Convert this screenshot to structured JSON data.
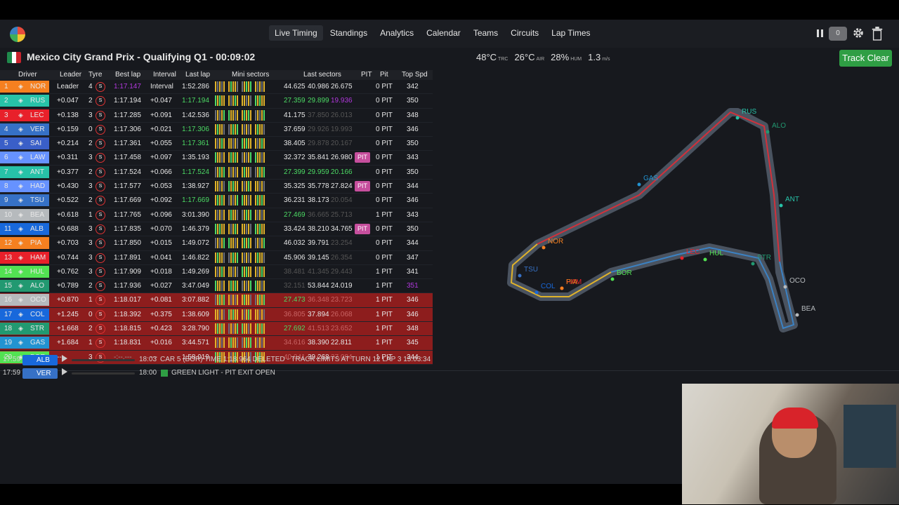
{
  "nav": {
    "tabs": [
      "Live Timing",
      "Standings",
      "Analytics",
      "Calendar",
      "Teams",
      "Circuits",
      "Lap Times"
    ],
    "active": 0,
    "counter": "0"
  },
  "session": {
    "title": "Mexico City Grand Prix - Qualifying Q1 - 00:09:02",
    "flag_colors": [
      "#1f8a4c",
      "#ffffff",
      "#c8232c"
    ]
  },
  "weather": [
    {
      "v": "48°C",
      "u": "TRC"
    },
    {
      "v": "26°C",
      "u": "AIR"
    },
    {
      "v": "28%",
      "u": "HUM"
    },
    {
      "v": "1.3",
      "u": "m/s"
    }
  ],
  "status_button": "Track Clear",
  "columns": {
    "driver": "Driver",
    "leader": "Leader",
    "tyre": "Tyre",
    "best": "Best lap",
    "interval": "Interval",
    "last": "Last lap",
    "mini": "Mini sectors",
    "sectors": "Last sectors",
    "pit": "PIT",
    "pits": "Pit",
    "speed": "Top Spd"
  },
  "rows": [
    {
      "pos": "1",
      "code": "NOR",
      "color": "#f58020",
      "gap": "Leader",
      "tyres": "4",
      "best": "1:17.147",
      "best_color": "#b138dd",
      "interval": "Interval",
      "last": "1:52.286",
      "last_color": "#e6e6e6",
      "s1": "44.625",
      "s2": "40.986",
      "s3": "26.675",
      "s1c": "#e6e6e6",
      "s2c": "#e6e6e6",
      "s3c": "#e6e6e6",
      "pit": "",
      "pits": "0 PIT",
      "speed": "342",
      "red": false
    },
    {
      "pos": "2",
      "code": "RUS",
      "color": "#27c2a8",
      "gap": "+0.047",
      "tyres": "2",
      "best": "1:17.194",
      "best_color": "#e6e6e6",
      "interval": "+0.047",
      "last": "1:17.194",
      "last_color": "#4cd964",
      "s1": "27.359",
      "s2": "29.899",
      "s3": "19.936",
      "s1c": "#4cd964",
      "s2c": "#4cd964",
      "s3c": "#b138dd",
      "pit": "",
      "pits": "0 PIT",
      "speed": "350",
      "red": false
    },
    {
      "pos": "3",
      "code": "LEC",
      "color": "#e8202a",
      "gap": "+0.138",
      "tyres": "3",
      "best": "1:17.285",
      "best_color": "#e6e6e6",
      "interval": "+0.091",
      "last": "1:42.536",
      "last_color": "#e6e6e6",
      "s1": "41.175",
      "s2": "37.850",
      "s3": "26.013",
      "s1c": "#e6e6e6",
      "s2c": "#555",
      "s3c": "#555",
      "pit": "",
      "pits": "0 PIT",
      "speed": "348",
      "red": false
    },
    {
      "pos": "4",
      "code": "VER",
      "color": "#3671c6",
      "gap": "+0.159",
      "tyres": "0",
      "best": "1:17.306",
      "best_color": "#e6e6e6",
      "interval": "+0.021",
      "last": "1:17.306",
      "last_color": "#4cd964",
      "s1": "37.659",
      "s2": "29.926",
      "s3": "19.993",
      "s1c": "#e6e6e6",
      "s2c": "#555",
      "s3c": "#555",
      "pit": "",
      "pits": "0 PIT",
      "speed": "346",
      "red": false
    },
    {
      "pos": "5",
      "code": "SAI",
      "color": "#3a5fc8",
      "gap": "+0.214",
      "tyres": "2",
      "best": "1:17.361",
      "best_color": "#e6e6e6",
      "interval": "+0.055",
      "last": "1:17.361",
      "last_color": "#4cd964",
      "s1": "38.405",
      "s2": "29.878",
      "s3": "20.167",
      "s1c": "#e6e6e6",
      "s2c": "#555",
      "s3c": "#555",
      "pit": "",
      "pits": "0 PIT",
      "speed": "350",
      "red": false
    },
    {
      "pos": "6",
      "code": "LAW",
      "color": "#6692ff",
      "gap": "+0.311",
      "tyres": "3",
      "best": "1:17.458",
      "best_color": "#e6e6e6",
      "interval": "+0.097",
      "last": "1:35.193",
      "last_color": "#e6e6e6",
      "s1": "32.372",
      "s2": "35.841",
      "s3": "26.980",
      "s1c": "#e6e6e6",
      "s2c": "#e6e6e6",
      "s3c": "#e6e6e6",
      "pit": "PIT",
      "pits": "0 PIT",
      "speed": "343",
      "red": false
    },
    {
      "pos": "7",
      "code": "ANT",
      "color": "#27c2a8",
      "gap": "+0.377",
      "tyres": "2",
      "best": "1:17.524",
      "best_color": "#e6e6e6",
      "interval": "+0.066",
      "last": "1:17.524",
      "last_color": "#4cd964",
      "s1": "27.399",
      "s2": "29.959",
      "s3": "20.166",
      "s1c": "#4cd964",
      "s2c": "#4cd964",
      "s3c": "#4cd964",
      "pit": "",
      "pits": "0 PIT",
      "speed": "350",
      "red": false
    },
    {
      "pos": "8",
      "code": "HAD",
      "color": "#6692ff",
      "gap": "+0.430",
      "tyres": "3",
      "best": "1:17.577",
      "best_color": "#e6e6e6",
      "interval": "+0.053",
      "last": "1:38.927",
      "last_color": "#e6e6e6",
      "s1": "35.325",
      "s2": "35.778",
      "s3": "27.824",
      "s1c": "#e6e6e6",
      "s2c": "#e6e6e6",
      "s3c": "#e6e6e6",
      "pit": "PIT",
      "pits": "0 PIT",
      "speed": "344",
      "red": false
    },
    {
      "pos": "9",
      "code": "TSU",
      "color": "#3671c6",
      "gap": "+0.522",
      "tyres": "2",
      "best": "1:17.669",
      "best_color": "#e6e6e6",
      "interval": "+0.092",
      "last": "1:17.669",
      "last_color": "#4cd964",
      "s1": "36.231",
      "s2": "38.173",
      "s3": "20.054",
      "s1c": "#e6e6e6",
      "s2c": "#e6e6e6",
      "s3c": "#555",
      "pit": "",
      "pits": "0 PIT",
      "speed": "346",
      "red": false
    },
    {
      "pos": "10",
      "code": "BEA",
      "color": "#b6babd",
      "gap": "+0.618",
      "tyres": "1",
      "best": "1:17.765",
      "best_color": "#e6e6e6",
      "interval": "+0.096",
      "last": "3:01.390",
      "last_color": "#e6e6e6",
      "s1": "27.469",
      "s2": "36.665",
      "s3": "25.713",
      "s1c": "#4cd964",
      "s2c": "#555",
      "s3c": "#555",
      "pit": "",
      "pits": "1 PIT",
      "speed": "343",
      "red": false
    },
    {
      "pos": "11",
      "code": "ALB",
      "color": "#1868db",
      "gap": "+0.688",
      "tyres": "3",
      "best": "1:17.835",
      "best_color": "#e6e6e6",
      "interval": "+0.070",
      "last": "1:46.379",
      "last_color": "#e6e6e6",
      "s1": "33.424",
      "s2": "38.210",
      "s3": "34.765",
      "s1c": "#e6e6e6",
      "s2c": "#e6e6e6",
      "s3c": "#e6e6e6",
      "pit": "PIT",
      "pits": "0 PIT",
      "speed": "350",
      "red": false
    },
    {
      "pos": "12",
      "code": "PIA",
      "color": "#f58020",
      "gap": "+0.703",
      "tyres": "3",
      "best": "1:17.850",
      "best_color": "#e6e6e6",
      "interval": "+0.015",
      "last": "1:49.072",
      "last_color": "#e6e6e6",
      "s1": "46.032",
      "s2": "39.791",
      "s3": "23.254",
      "s1c": "#e6e6e6",
      "s2c": "#e6e6e6",
      "s3c": "#555",
      "pit": "",
      "pits": "0 PIT",
      "speed": "344",
      "red": false
    },
    {
      "pos": "13",
      "code": "HAM",
      "color": "#e8202a",
      "gap": "+0.744",
      "tyres": "3",
      "best": "1:17.891",
      "best_color": "#e6e6e6",
      "interval": "+0.041",
      "last": "1:46.822",
      "last_color": "#e6e6e6",
      "s1": "45.906",
      "s2": "39.145",
      "s3": "26.354",
      "s1c": "#e6e6e6",
      "s2c": "#e6e6e6",
      "s3c": "#555",
      "pit": "",
      "pits": "0 PIT",
      "speed": "347",
      "red": false
    },
    {
      "pos": "14",
      "code": "HUL",
      "color": "#52e252",
      "gap": "+0.762",
      "tyres": "3",
      "best": "1:17.909",
      "best_color": "#e6e6e6",
      "interval": "+0.018",
      "last": "1:49.269",
      "last_color": "#e6e6e6",
      "s1": "38.481",
      "s2": "41.345",
      "s3": "29.443",
      "s1c": "#555",
      "s2c": "#555",
      "s3c": "#555",
      "pit": "",
      "pits": "1 PIT",
      "speed": "341",
      "red": false
    },
    {
      "pos": "15",
      "code": "ALO",
      "color": "#229971",
      "gap": "+0.789",
      "tyres": "2",
      "best": "1:17.936",
      "best_color": "#e6e6e6",
      "interval": "+0.027",
      "last": "3:47.049",
      "last_color": "#e6e6e6",
      "s1": "32.151",
      "s2": "53.844",
      "s3": "24.019",
      "s1c": "#555",
      "s2c": "#e6e6e6",
      "s3c": "#e6e6e6",
      "pit": "",
      "pits": "1 PIT",
      "speed": "351",
      "speed_color": "#b138dd",
      "red": false
    },
    {
      "pos": "16",
      "code": "OCO",
      "color": "#b6babd",
      "gap": "+0.870",
      "tyres": "1",
      "best": "1:18.017",
      "best_color": "#e6e6e6",
      "interval": "+0.081",
      "last": "3:07.882",
      "last_color": "#e6e6e6",
      "s1": "27.473",
      "s2": "36.348",
      "s3": "23.723",
      "s1c": "#4cd964",
      "s2c": "#c86464",
      "s3c": "#c86464",
      "pit": "",
      "pits": "1 PIT",
      "speed": "346",
      "red": true
    },
    {
      "pos": "17",
      "code": "COL",
      "color": "#1868db",
      "gap": "+1.245",
      "tyres": "0",
      "best": "1:18.392",
      "best_color": "#e6e6e6",
      "interval": "+0.375",
      "last": "1:38.609",
      "last_color": "#e6e6e6",
      "s1": "36.805",
      "s2": "37.894",
      "s3": "26.068",
      "s1c": "#c86464",
      "s2c": "#e6e6e6",
      "s3c": "#c86464",
      "pit": "",
      "pits": "1 PIT",
      "speed": "346",
      "red": true
    },
    {
      "pos": "18",
      "code": "STR",
      "color": "#229971",
      "gap": "+1.668",
      "tyres": "2",
      "best": "1:18.815",
      "best_color": "#e6e6e6",
      "interval": "+0.423",
      "last": "3:28.790",
      "last_color": "#e6e6e6",
      "s1": "27.692",
      "s2": "41.513",
      "s3": "23.652",
      "s1c": "#4cd964",
      "s2c": "#c86464",
      "s3c": "#c86464",
      "pit": "",
      "pits": "1 PIT",
      "speed": "348",
      "red": true
    },
    {
      "pos": "19",
      "code": "GAS",
      "color": "#2293d1",
      "gap": "+1.684",
      "tyres": "1",
      "best": "1:18.831",
      "best_color": "#e6e6e6",
      "interval": "+0.016",
      "last": "3:44.571",
      "last_color": "#e6e6e6",
      "s1": "34.616",
      "s2": "38.390",
      "s3": "22.811",
      "s1c": "#c86464",
      "s2c": "#e6e6e6",
      "s3c": "#e6e6e6",
      "pit": "",
      "pits": "1 PIT",
      "speed": "345",
      "red": true
    },
    {
      "pos": "20",
      "code": "BOR",
      "color": "#52e252",
      "gap": "---",
      "tyres": "3",
      "best": "-:--.---",
      "best_color": "#999",
      "interval": "---",
      "last": "1:58.019",
      "last_color": "#e6e6e6",
      "s1": "40.041",
      "s2": "39.268",
      "s3": "37.084",
      "s1c": "#c86464",
      "s2c": "#e6e6e6",
      "s3c": "#c86464",
      "pit": "",
      "pits": "1 PIT",
      "speed": "344",
      "red": true
    }
  ],
  "events": [
    {
      "time": "17:59",
      "code": "ALB",
      "color": "#1868db",
      "etime": "18:03",
      "msg": "CAR 5 (BOR) TIME 1:18.964 DELETED - TRACK LIMITS AT TURN 12 LAP 3 15:03:34",
      "flag": ""
    },
    {
      "time": "17:59",
      "code": "VER",
      "color": "#3671c6",
      "etime": "18:00",
      "msg": "GREEN LIGHT - PIT EXIT OPEN",
      "flag": "#2f9e44"
    }
  ],
  "map_labels": [
    "RUS",
    "ALO",
    "GAS",
    "ANT",
    "NOR",
    "LEC",
    "HUL",
    "STR",
    "TSU",
    "COL",
    "HAM",
    "PIA",
    "BOR",
    "OCO",
    "BEA"
  ]
}
